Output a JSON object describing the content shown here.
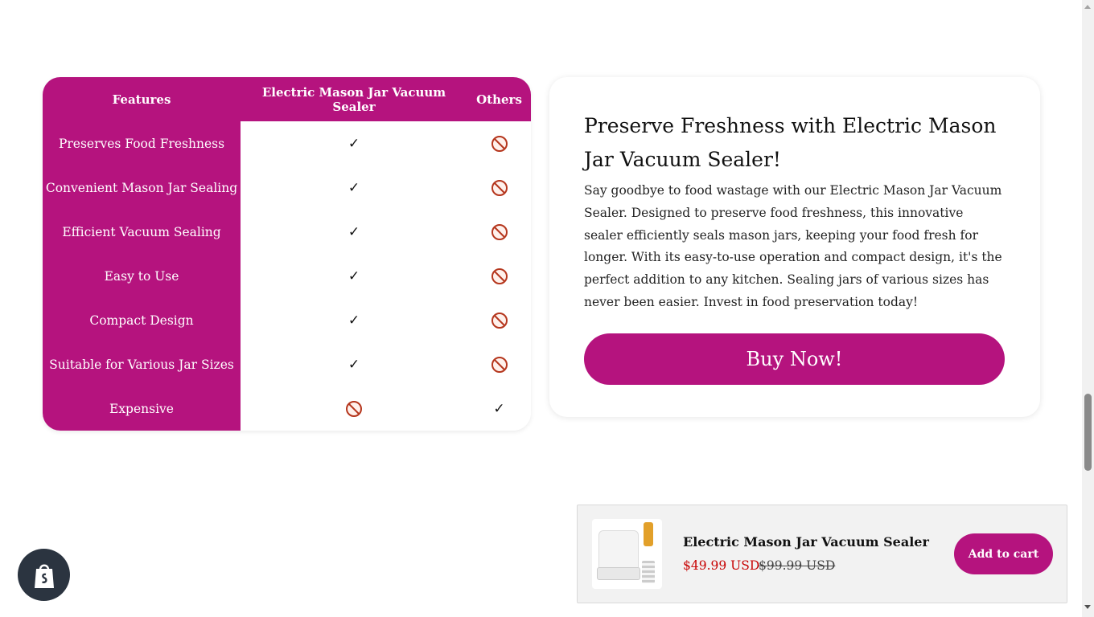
{
  "comparison": {
    "headers": [
      "Features",
      "Electric Mason Jar Vacuum Sealer",
      "Others"
    ],
    "check_symbol": "✓",
    "rows": [
      {
        "feature": "Preserves Food Freshness",
        "product": "check",
        "others": "no"
      },
      {
        "feature": "Convenient Mason Jar Sealing",
        "product": "check",
        "others": "no"
      },
      {
        "feature": "Efficient Vacuum Sealing",
        "product": "check",
        "others": "no"
      },
      {
        "feature": "Easy to Use",
        "product": "check",
        "others": "no"
      },
      {
        "feature": "Compact Design",
        "product": "check",
        "others": "no"
      },
      {
        "feature": "Suitable for Various Jar Sizes",
        "product": "check",
        "others": "no"
      },
      {
        "feature": "Expensive",
        "product": "no",
        "others": "check"
      }
    ]
  },
  "promo": {
    "title": "Preserve Freshness with Electric Mason Jar Vacuum Sealer!",
    "body": "Say goodbye to food wastage with our Electric Mason Jar Vacuum Sealer. Designed to preserve food freshness, this innovative sealer efficiently seals mason jars, keeping your food fresh for longer. With its easy-to-use operation and compact design, it's the perfect addition to any kitchen. Sealing jars of various sizes has never been easier. Invest in food preservation today!",
    "button": "Buy Now!"
  },
  "sticky_cart": {
    "product_title": "Electric Mason Jar Vacuum Sealer",
    "price": "$49.99 USD",
    "compare_price": "$99.99 USD",
    "button": "Add to cart"
  },
  "colors": {
    "brand": "#b5137e",
    "sale_price": "#c70000",
    "shop_badge": "#2b3440"
  },
  "icons": {
    "check": "check-icon",
    "no": "prohibited-icon",
    "shopify": "shopify-bag-icon"
  }
}
